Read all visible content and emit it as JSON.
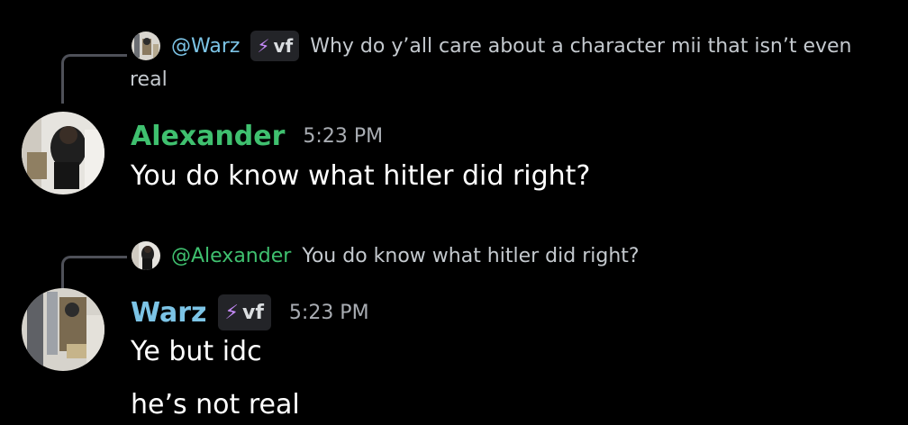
{
  "reply1": {
    "mention": "@Warz",
    "tag": "vf",
    "text_line1": "Why do y’all care about a character mii that isn’t even",
    "text_line2": "real"
  },
  "message1": {
    "author": "Alexander",
    "time": "5:23 PM",
    "content": "You do know what hitler did right?"
  },
  "reply2": {
    "mention": "@Alexander",
    "text": "You do know what hitler did right?"
  },
  "message2": {
    "author": "Warz",
    "tag": "vf",
    "time": "5:23 PM",
    "lines": [
      "Ye but idc",
      "he’s not real"
    ]
  },
  "colors": {
    "background": "#000000",
    "alexander": "#3fc06f",
    "warz": "#7cc4e6",
    "tag_bolt": "#c58af9"
  },
  "icons": [
    "lightning-bolt-icon"
  ]
}
